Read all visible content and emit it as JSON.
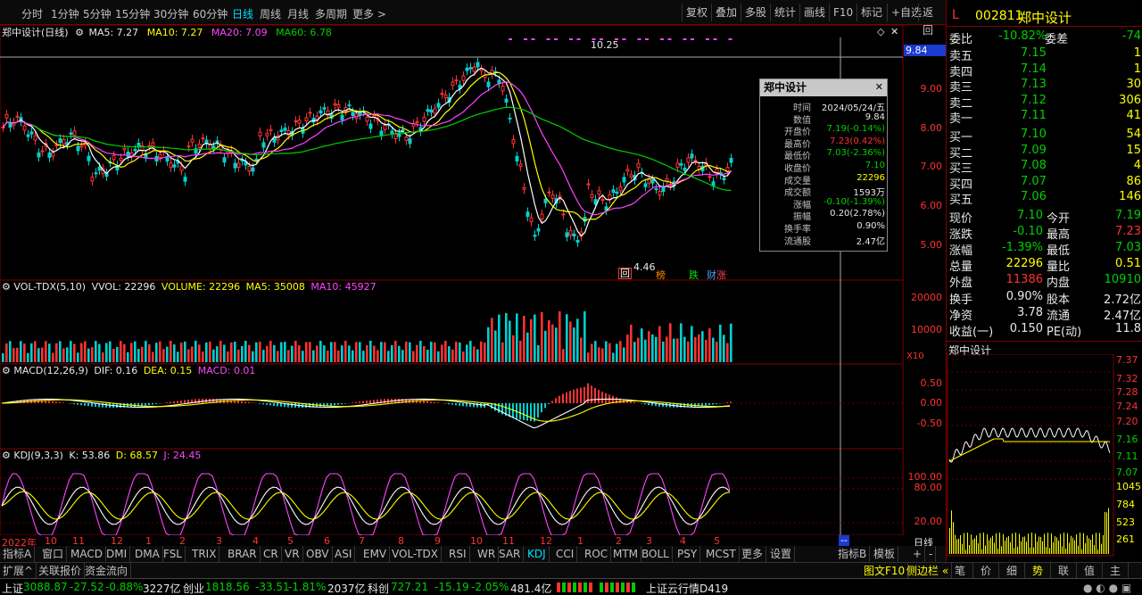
{
  "toolbar": {
    "periods": [
      "分时",
      "1分钟",
      "5分钟",
      "15分钟",
      "30分钟",
      "60分钟",
      "日线",
      "周线",
      "月线",
      "多周期",
      "更多 >"
    ],
    "active_period": "日线",
    "buttons": [
      "复权",
      "叠加",
      "多股",
      "统计",
      "画线",
      "F10",
      "标记",
      "+自选",
      "返回"
    ]
  },
  "main": {
    "title": "郑中设计(日线)",
    "ma": {
      "ma5": "MA5: 7.27",
      "ma10": "MA10: 7.27",
      "ma20": "MA20: 7.09",
      "ma60": "MA60: 6.78"
    },
    "high_label": "10.25",
    "low_label": "4.46",
    "cursor_price": "9.84",
    "price_axis": [
      "9.00",
      "8.00",
      "7.00",
      "6.00",
      "5.00"
    ],
    "events": [
      "回",
      "榜",
      "跌",
      "财",
      "涨"
    ]
  },
  "volume": {
    "title": "VOL-TDX(5,10)",
    "vvol": "VVOL: 22296",
    "volume": "VOLUME: 22296",
    "ma5": "MA5: 35008",
    "ma10": "MA10: 45927",
    "axis": [
      "20000",
      "10000"
    ],
    "unit": "X10"
  },
  "macd": {
    "title": "MACD(12,26,9)",
    "dif": "DIF: 0.16",
    "dea": "DEA: 0.15",
    "macd": "MACD: 0.01",
    "axis": [
      "0.50",
      "0.00",
      "-0.50"
    ]
  },
  "kdj": {
    "title": "KDJ(9,3,3)",
    "k": "K: 53.86",
    "d": "D: 68.57",
    "j": "J: 24.45",
    "axis": [
      "100.00",
      "80.00",
      "20.00"
    ]
  },
  "date_axis": [
    "2022年",
    "10",
    "11",
    "12",
    "1",
    "2",
    "3",
    "4",
    "5",
    "6",
    "7",
    "8",
    "9",
    "10",
    "11",
    "12",
    "1",
    "2",
    "3",
    "4",
    "5"
  ],
  "date_axis_right": "--",
  "date_axis_mode": "日线",
  "tooltip": {
    "title": "郑中设计",
    "rows": [
      {
        "k": "时间",
        "v": "2024/05/24/五",
        "c": "wht"
      },
      {
        "k": "数值",
        "v": "9.84",
        "c": "wht"
      },
      {
        "k": "开盘价",
        "v": "7.19(-0.14%)",
        "c": "grn"
      },
      {
        "k": "最高价",
        "v": "7.23(0.42%)",
        "c": "red"
      },
      {
        "k": "最低价",
        "v": "7.03(-2.36%)",
        "c": "grn"
      },
      {
        "k": "收盘价",
        "v": "7.10",
        "c": "grn"
      },
      {
        "k": "成交量",
        "v": "22296",
        "c": "yel"
      },
      {
        "k": "成交额",
        "v": "1593万",
        "c": "wht"
      },
      {
        "k": "涨幅",
        "v": "-0.10(-1.39%)",
        "c": "grn"
      },
      {
        "k": "振幅",
        "v": "0.20(2.78%)",
        "c": "wht"
      },
      {
        "k": "换手率",
        "v": "0.90%",
        "c": "wht"
      },
      {
        "k": "流通股",
        "v": "2.47亿",
        "c": "wht"
      }
    ]
  },
  "stock": {
    "mark": "L",
    "code": "002811",
    "name": "郑中设计"
  },
  "orderbook": {
    "weibi_label": "委比",
    "weibi": "-10.82%",
    "weicha_label": "委差",
    "weicha": "-74",
    "asks": [
      {
        "label": "卖五",
        "price": "7.15",
        "vol": "1"
      },
      {
        "label": "卖四",
        "price": "7.14",
        "vol": "1"
      },
      {
        "label": "卖三",
        "price": "7.13",
        "vol": "30"
      },
      {
        "label": "卖二",
        "price": "7.12",
        "vol": "306"
      },
      {
        "label": "卖一",
        "price": "7.11",
        "vol": "41"
      }
    ],
    "bids": [
      {
        "label": "买一",
        "price": "7.10",
        "vol": "54"
      },
      {
        "label": "买二",
        "price": "7.09",
        "vol": "15"
      },
      {
        "label": "买三",
        "price": "7.08",
        "vol": "4"
      },
      {
        "label": "买四",
        "price": "7.07",
        "vol": "86"
      },
      {
        "label": "买五",
        "price": "7.06",
        "vol": "146"
      }
    ]
  },
  "quote": [
    {
      "l1": "现价",
      "v1": "7.10",
      "c1": "grn",
      "l2": "今开",
      "v2": "7.19",
      "c2": "grn"
    },
    {
      "l1": "涨跌",
      "v1": "-0.10",
      "c1": "grn",
      "l2": "最高",
      "v2": "7.23",
      "c2": "red"
    },
    {
      "l1": "涨幅",
      "v1": "-1.39%",
      "c1": "grn",
      "l2": "最低",
      "v2": "7.03",
      "c2": "grn"
    },
    {
      "l1": "总量",
      "v1": "22296",
      "c1": "yel",
      "l2": "量比",
      "v2": "0.51",
      "c2": "yel"
    },
    {
      "l1": "外盘",
      "v1": "11386",
      "c1": "red",
      "l2": "内盘",
      "v2": "10910",
      "c2": "grn"
    }
  ],
  "quote2": [
    {
      "l1": "换手",
      "v1": "0.90%",
      "l2": "股本",
      "v2": "2.72亿"
    },
    {
      "l1": "净资",
      "v1": "3.78",
      "l2": "流通",
      "v2": "2.47亿"
    },
    {
      "l1": "收益(一)",
      "v1": "0.150",
      "l2": "PE(动)",
      "v2": "11.8"
    }
  ],
  "mini": {
    "title": "郑中设计",
    "axis": [
      "7.37",
      "7.32",
      "7.28",
      "7.24",
      "7.20",
      "7.16",
      "7.11",
      "7.07",
      "1045",
      "784",
      "523",
      "261"
    ]
  },
  "indicator_tabs": [
    "指标A",
    "窗口",
    "MACD",
    "DMI",
    "DMA",
    "FSL",
    "TRIX",
    "BRAR",
    "CR",
    "VR",
    "OBV",
    "ASI",
    "EMV",
    "VOL-TDX",
    "RSI",
    "WR",
    "SAR",
    "KDJ",
    "CCI",
    "ROC",
    "MTM",
    "BOLL",
    "PSY",
    "MCST",
    "更多",
    "设置"
  ],
  "active_indicator": "KDJ",
  "indicator_right": [
    "指标B",
    "模板",
    "+",
    "-"
  ],
  "bottom_tabs": [
    "扩展^",
    "关联报价",
    "资金流向"
  ],
  "bottom_right": {
    "f10": "图文F10",
    "side": "侧边栏 «",
    "tabs": [
      "笔",
      "价",
      "细",
      "势",
      "联",
      "值",
      "主"
    ]
  },
  "status": {
    "sh_label": "上证",
    "sh": "3088.87",
    "sh_chg": "-27.52",
    "sh_pct": "-0.88%",
    "sh_amt": "3227亿",
    "cy_label": "创业",
    "cy": "1818.56",
    "cy_chg": "-33.51",
    "cy_pct": "-1.81%",
    "cy_amt": "2037亿",
    "kc_label": "科创",
    "kc": "727.21",
    "kc_chg": "-15.19",
    "kc_pct": "-2.05%",
    "kc_amt": "481.4亿",
    "news": "上证云行情D419"
  }
}
